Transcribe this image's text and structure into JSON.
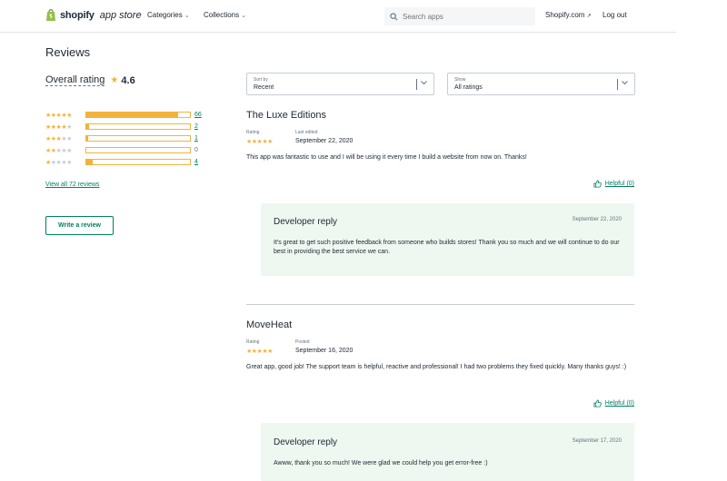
{
  "header": {
    "brand": "shopify",
    "brand_sub": "app store",
    "nav": {
      "categories": "Categories",
      "collections": "Collections"
    },
    "search_placeholder": "Search apps",
    "shopify_link": "Shopify.com",
    "logout": "Log out"
  },
  "reviews": {
    "title": "Reviews",
    "overall_label": "Overall rating",
    "overall_value": "4.6",
    "distribution": [
      {
        "stars": 5,
        "count": "66",
        "fraction": 0.89
      },
      {
        "stars": 4,
        "count": "2",
        "fraction": 0.03
      },
      {
        "stars": 3,
        "count": "1",
        "fraction": 0.015
      },
      {
        "stars": 2,
        "count": "0",
        "fraction": 0
      },
      {
        "stars": 1,
        "count": "4",
        "fraction": 0.06
      }
    ],
    "view_all": "View all 72 reviews",
    "write_review": "Write a review"
  },
  "filters": {
    "sort": {
      "label": "Sort by",
      "value": "Recent"
    },
    "show": {
      "label": "Show",
      "value": "All ratings"
    }
  },
  "items": [
    {
      "store": "The Luxe Editions",
      "rating_label": "Rating",
      "rating": 5,
      "date_label": "Last edited",
      "date": "September 22, 2020",
      "text": "This app was fantastic to use and I will be using it every time I build a website from now on. Thanks!",
      "helpful": "Helpful (0)",
      "reply": {
        "title": "Developer reply",
        "date": "September 22, 2020",
        "text": "It's great to get such positive feedback from someone who builds stores! Thank you so much and we will continue to do our best in providing the best service we can."
      }
    },
    {
      "store": "MoveHeat",
      "rating_label": "Rating",
      "rating": 5,
      "date_label": "Posted",
      "date": "September 16, 2020",
      "text": "Great app, good job! The support team is helpful, reactive and professional! I had two problems they fixed quickly. Many thanks guys! :)",
      "helpful": "Helpful (0)",
      "reply": {
        "title": "Developer reply",
        "date": "September 17, 2020",
        "text": "Awww, thank you so much! We were glad we could help you get error-free :)"
      }
    }
  ],
  "colors": {
    "accent": "#008060",
    "star": "#f2b33d",
    "reply_bg": "#eef8f0"
  }
}
